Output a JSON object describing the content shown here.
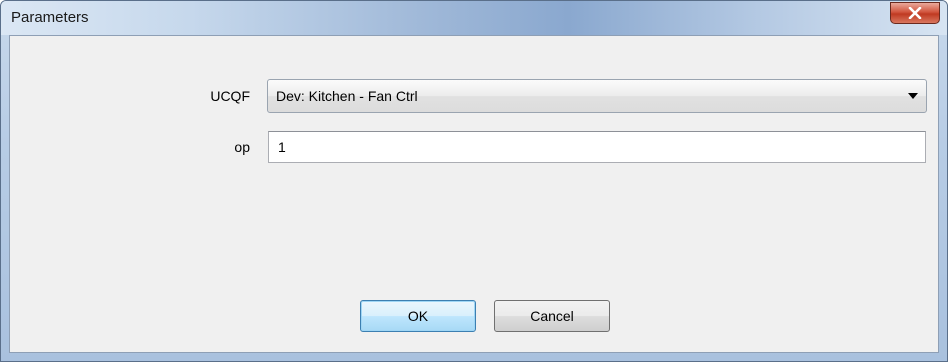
{
  "window": {
    "title": "Parameters"
  },
  "form": {
    "ucqf_label": "UCQF",
    "ucqf_value": "Dev: Kitchen - Fan Ctrl",
    "op_label": "op",
    "op_value": "1"
  },
  "buttons": {
    "ok_label": "OK",
    "cancel_label": "Cancel"
  },
  "icons": {
    "close": "close-icon",
    "dropdown": "chevron-down-icon"
  },
  "colors": {
    "close_button": "#c8452c",
    "client_background": "#f0f0f0",
    "default_button_border": "#3c7fb1"
  }
}
